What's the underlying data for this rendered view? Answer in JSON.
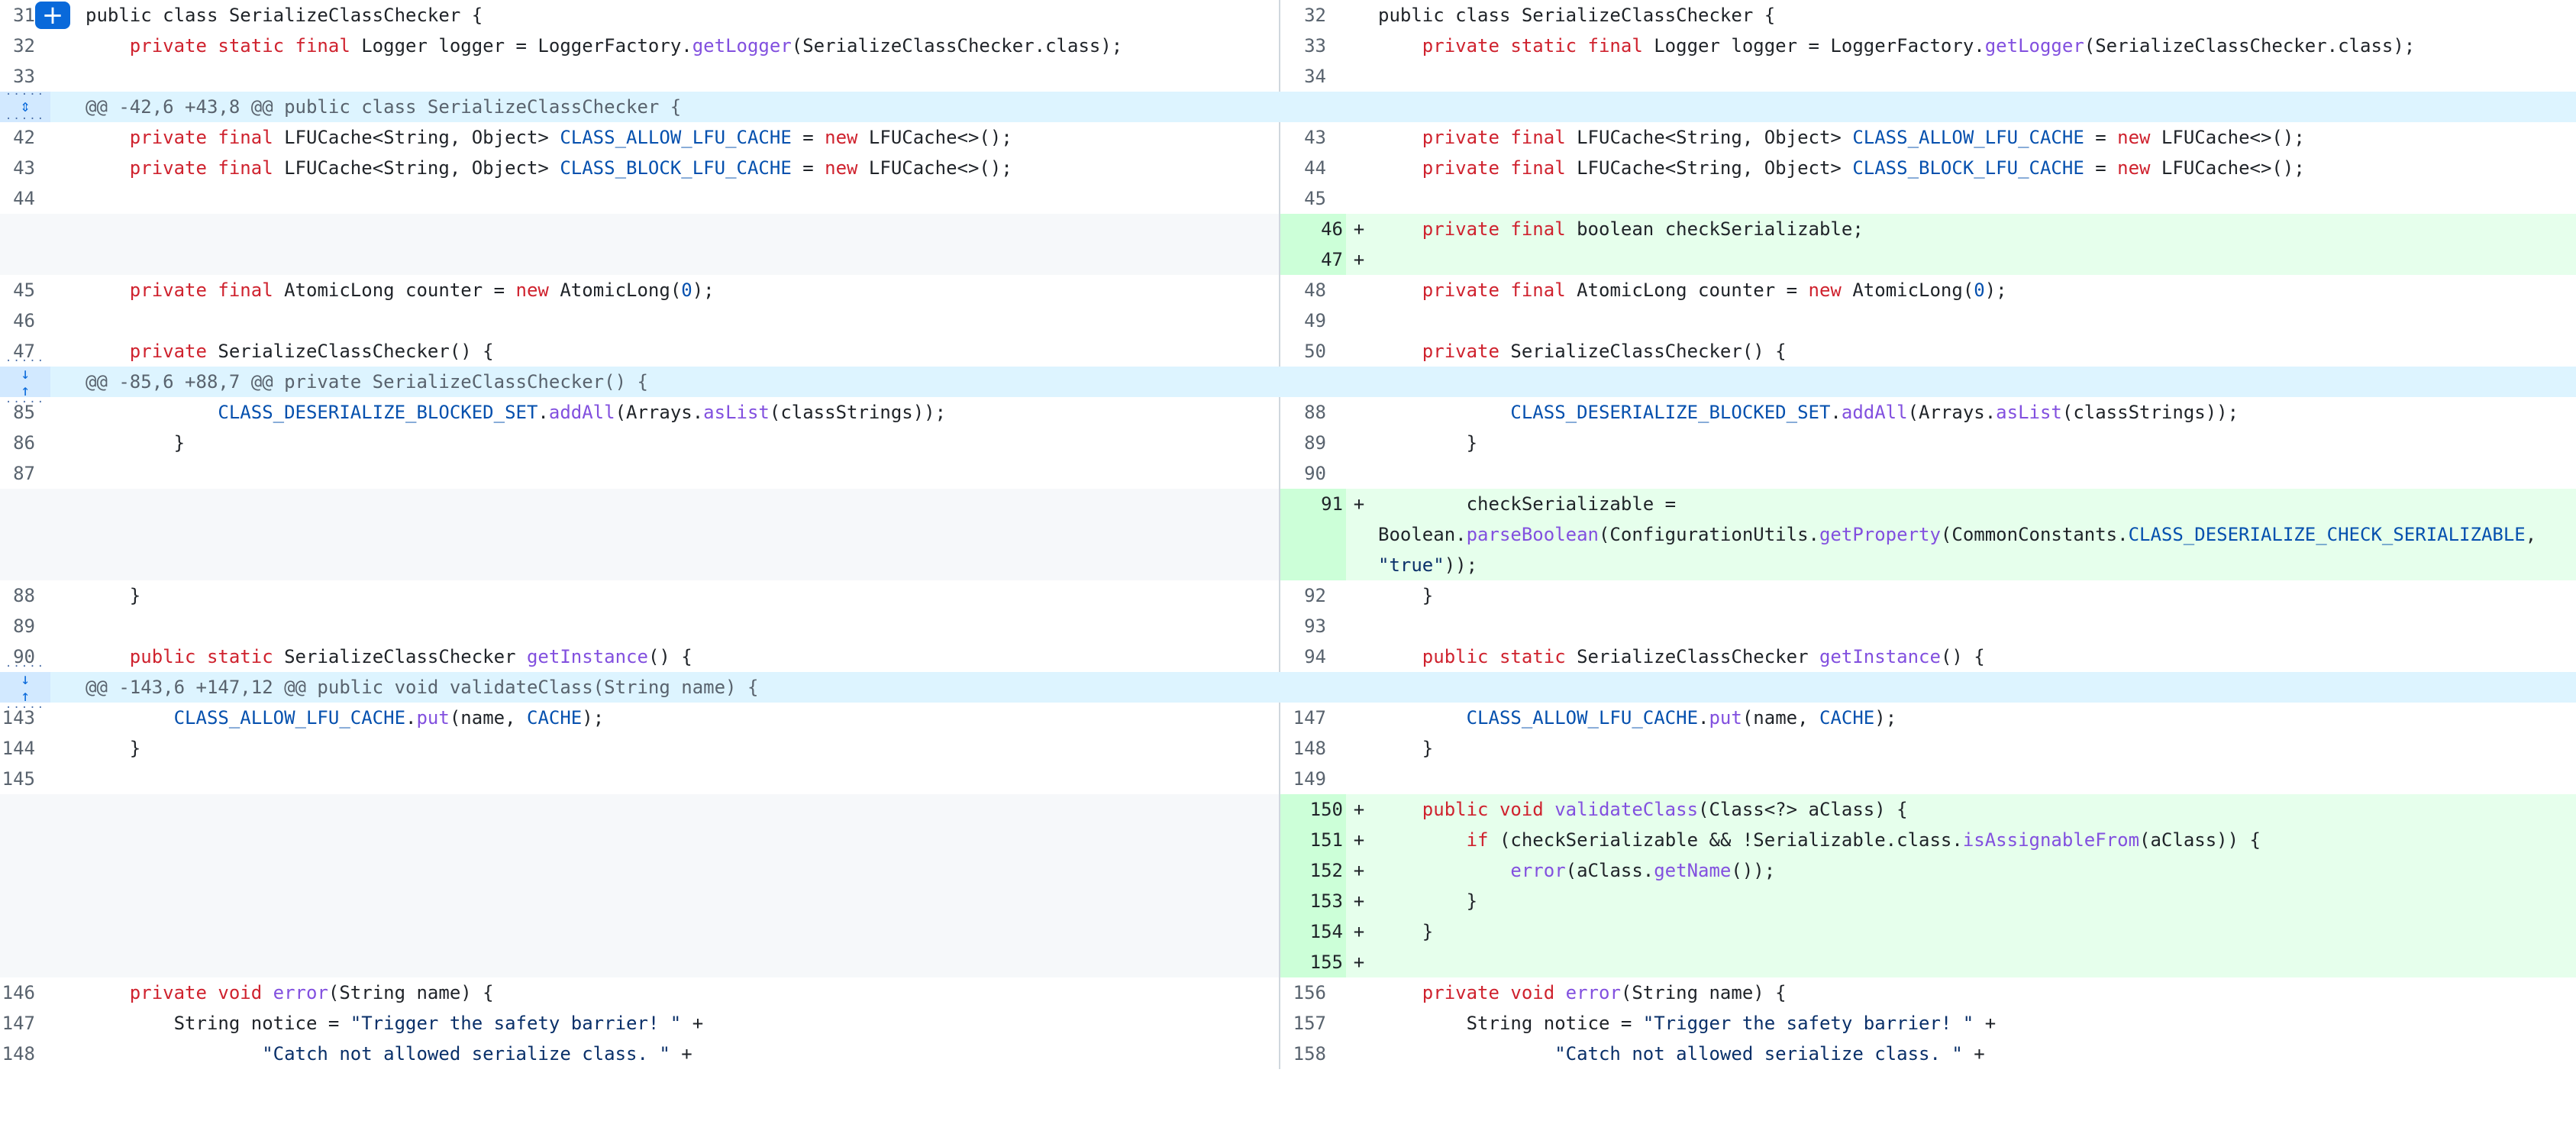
{
  "colors": {
    "hunk_bg": "#ddf4ff",
    "addition_bg": "#e6ffec",
    "addition_num_bg": "#ccffd8",
    "empty_bg": "#f6f8fa",
    "keyword": "#cf222e",
    "function": "#8250df",
    "constant": "#0550ae",
    "string": "#0a3069"
  },
  "icons": {
    "expand": "expand-icon",
    "expand_up": "expand-up-icon",
    "expand_down": "expand-down-icon",
    "add_comment": "plus-icon"
  },
  "rows": [
    {
      "type": "context",
      "ln": "31",
      "rn": "32",
      "segs": [
        [
          "public class SerializeClassChecker {",
          ""
        ]
      ]
    },
    {
      "type": "context",
      "ln": "32",
      "rn": "33",
      "segs": [
        [
          "    private static final ",
          "kw"
        ],
        [
          "Logger logger = LoggerFactory.",
          ""
        ],
        [
          "getLogger",
          "fn"
        ],
        [
          "(SerializeClassChecker.class);",
          ""
        ]
      ]
    },
    {
      "type": "context",
      "ln": "33",
      "rn": "34",
      "segs": []
    },
    {
      "type": "hunk",
      "text": "@@ -42,6 +43,8 @@ public class SerializeClassChecker {"
    },
    {
      "type": "context",
      "ln": "42",
      "rn": "43",
      "segs": [
        [
          "    private final ",
          "kw"
        ],
        [
          "LFUCache<String, Object> ",
          ""
        ],
        [
          "CLASS_ALLOW_LFU_CACHE",
          "cn"
        ],
        [
          " = ",
          ""
        ],
        [
          "new",
          "kw"
        ],
        [
          " LFUCache<>();",
          ""
        ]
      ]
    },
    {
      "type": "context",
      "ln": "43",
      "rn": "44",
      "segs": [
        [
          "    private final ",
          "kw"
        ],
        [
          "LFUCache<String, Object> ",
          ""
        ],
        [
          "CLASS_BLOCK_LFU_CACHE",
          "cn"
        ],
        [
          " = ",
          ""
        ],
        [
          "new",
          "kw"
        ],
        [
          " LFUCache<>();",
          ""
        ]
      ]
    },
    {
      "type": "context",
      "ln": "44",
      "rn": "45",
      "segs": []
    },
    {
      "type": "add",
      "rn": "46",
      "segs": [
        [
          "    private final ",
          "kw"
        ],
        [
          "boolean checkSerializable;",
          ""
        ]
      ]
    },
    {
      "type": "add",
      "rn": "47",
      "segs": []
    },
    {
      "type": "context",
      "ln": "45",
      "rn": "48",
      "segs": [
        [
          "    private final ",
          "kw"
        ],
        [
          "AtomicLong counter = ",
          ""
        ],
        [
          "new",
          "kw"
        ],
        [
          " AtomicLong(",
          ""
        ],
        [
          "0",
          "cn"
        ],
        [
          ");",
          ""
        ]
      ]
    },
    {
      "type": "context",
      "ln": "46",
      "rn": "49",
      "segs": []
    },
    {
      "type": "context",
      "ln": "47",
      "rn": "50",
      "segs": [
        [
          "    private ",
          "kw"
        ],
        [
          "SerializeClassChecker() {",
          ""
        ]
      ]
    },
    {
      "type": "hunk",
      "text": "@@ -85,6 +88,7 @@ private SerializeClassChecker() {"
    },
    {
      "type": "context",
      "ln": "85",
      "rn": "88",
      "segs": [
        [
          "            ",
          ""
        ],
        [
          "CLASS_DESERIALIZE_BLOCKED_SET",
          "cn"
        ],
        [
          ".",
          ""
        ],
        [
          "addAll",
          "fn"
        ],
        [
          "(Arrays.",
          ""
        ],
        [
          "asList",
          "fn"
        ],
        [
          "(classStrings));",
          ""
        ]
      ]
    },
    {
      "type": "context",
      "ln": "86",
      "rn": "89",
      "segs": [
        [
          "        }",
          ""
        ]
      ]
    },
    {
      "type": "context",
      "ln": "87",
      "rn": "90",
      "segs": []
    },
    {
      "type": "addwrap",
      "rn": "91",
      "lines": [
        [
          [
            "        checkSerializable =",
            ""
          ]
        ],
        [
          [
            "Boolean.",
            ""
          ],
          [
            "parseBoolean",
            "fn"
          ],
          [
            "(ConfigurationUtils.",
            ""
          ],
          [
            "getProperty",
            "fn"
          ],
          [
            "(CommonConstants.",
            ""
          ],
          [
            "CLASS_DESERIALIZE_CHECK_SERIALIZABLE",
            "cn"
          ],
          [
            ",",
            ""
          ]
        ],
        [
          [
            "\"true\"",
            "st"
          ],
          [
            "));",
            ""
          ]
        ]
      ]
    },
    {
      "type": "context",
      "ln": "88",
      "rn": "92",
      "segs": [
        [
          "    }",
          ""
        ]
      ]
    },
    {
      "type": "context",
      "ln": "89",
      "rn": "93",
      "segs": []
    },
    {
      "type": "context",
      "ln": "90",
      "rn": "94",
      "segs": [
        [
          "    public static ",
          "kw"
        ],
        [
          "SerializeClassChecker ",
          ""
        ],
        [
          "getInstance",
          "fn"
        ],
        [
          "() {",
          ""
        ]
      ]
    },
    {
      "type": "hunk",
      "text": "@@ -143,6 +147,12 @@ public void validateClass(String name) {"
    },
    {
      "type": "context",
      "ln": "143",
      "rn": "147",
      "segs": [
        [
          "        ",
          ""
        ],
        [
          "CLASS_ALLOW_LFU_CACHE",
          "cn"
        ],
        [
          ".",
          ""
        ],
        [
          "put",
          "fn"
        ],
        [
          "(name, ",
          ""
        ],
        [
          "CACHE",
          "cn"
        ],
        [
          ");",
          ""
        ]
      ]
    },
    {
      "type": "context",
      "ln": "144",
      "rn": "148",
      "segs": [
        [
          "    }",
          ""
        ]
      ]
    },
    {
      "type": "context",
      "ln": "145",
      "rn": "149",
      "segs": []
    },
    {
      "type": "add",
      "rn": "150",
      "segs": [
        [
          "    public void ",
          "kw"
        ],
        [
          "validateClass",
          "fn"
        ],
        [
          "(Class<?> aClass) {",
          ""
        ]
      ]
    },
    {
      "type": "add",
      "rn": "151",
      "segs": [
        [
          "        if ",
          "kw"
        ],
        [
          "(checkSerializable && !Serializable.class.",
          ""
        ],
        [
          "isAssignableFrom",
          "fn"
        ],
        [
          "(aClass)) {",
          ""
        ]
      ]
    },
    {
      "type": "add",
      "rn": "152",
      "segs": [
        [
          "            ",
          ""
        ],
        [
          "error",
          "fn"
        ],
        [
          "(aClass.",
          ""
        ],
        [
          "getName",
          "fn"
        ],
        [
          "());",
          ""
        ]
      ]
    },
    {
      "type": "add",
      "rn": "153",
      "segs": [
        [
          "        }",
          ""
        ]
      ]
    },
    {
      "type": "add",
      "rn": "154",
      "segs": [
        [
          "    }",
          ""
        ]
      ]
    },
    {
      "type": "add",
      "rn": "155",
      "segs": []
    },
    {
      "type": "context",
      "ln": "146",
      "rn": "156",
      "segs": [
        [
          "    private void ",
          "kw"
        ],
        [
          "error",
          "fn"
        ],
        [
          "(String name) {",
          ""
        ]
      ]
    },
    {
      "type": "context",
      "ln": "147",
      "rn": "157",
      "segs": [
        [
          "        String notice = ",
          ""
        ],
        [
          "\"Trigger the safety barrier! \"",
          "st"
        ],
        [
          " +",
          ""
        ]
      ]
    },
    {
      "type": "context",
      "ln": "148",
      "rn": "158",
      "segs": [
        [
          "                ",
          ""
        ],
        [
          "\"Catch not allowed serialize class. \"",
          "st"
        ],
        [
          " +",
          ""
        ]
      ]
    }
  ]
}
